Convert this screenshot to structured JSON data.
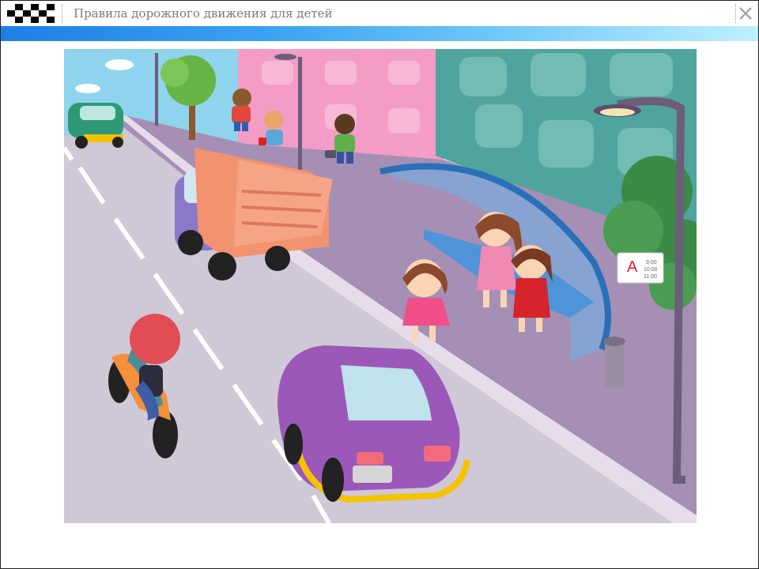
{
  "window": {
    "title": "Правила дорожного движения для детей",
    "logo_icon": "checkered-flag-icon",
    "close_icon": "close-icon"
  },
  "colors": {
    "title_text": "#7a7a7a",
    "bar_start": "#1e7fe6",
    "bar_end": "#bff0ff",
    "sky": "#8fd4ee",
    "road": "#cfc8d6",
    "sidewalk": "#a58fb5",
    "pink_building": "#f49cc6",
    "teal_building": "#4fa59e",
    "purple_car": "#9c58b8",
    "green_car": "#2e9a75"
  },
  "scene": {
    "bus_stop_sign": {
      "letter": "А",
      "times": [
        "9:00",
        "10:00",
        "11:00"
      ]
    }
  }
}
